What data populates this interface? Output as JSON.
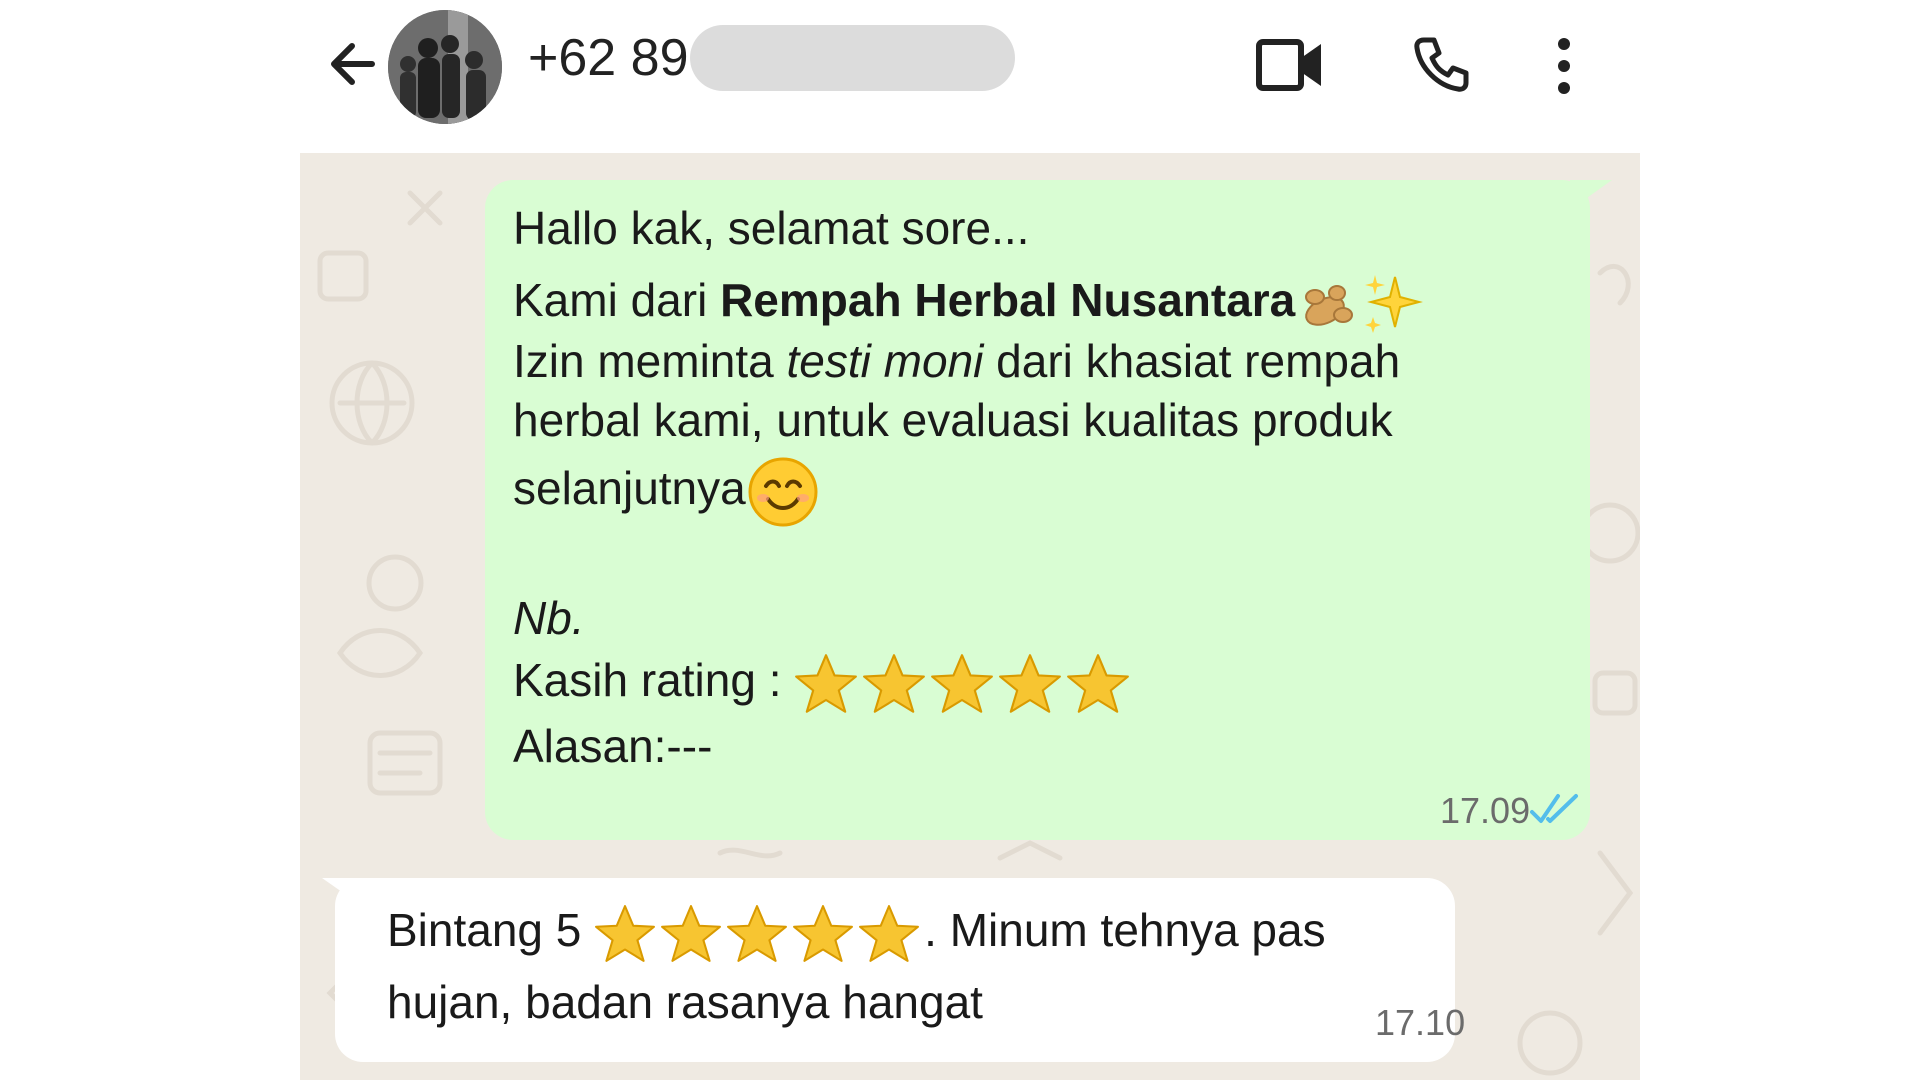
{
  "header": {
    "contact_number": "+62 89",
    "back_icon": "arrow-left-icon",
    "video_icon": "video-camera-icon",
    "call_icon": "phone-icon",
    "menu_icon": "more-vertical-icon"
  },
  "outgoing_message": {
    "line1": "Hallo kak, selamat sore...",
    "line2_prefix": "Kami dari ",
    "line2_brand": "Rempah Herbal Nusantara",
    "line3_prefix": "Izin meminta ",
    "line3_italic": "testi moni",
    "line3_suffix": " dari khasiat rempah",
    "line4": "herbal kami, untuk evaluasi kualitas produk",
    "line5": "selanjutnya",
    "note_label": "Nb.",
    "rating_label": "Kasih rating : ",
    "rating_stars": 5,
    "reason_label": "Alasan:---",
    "time": "17.09",
    "status_icon": "double-check-read-icon"
  },
  "incoming_message": {
    "prefix": "Bintang 5 ",
    "stars": 5,
    "suffix": ". Minum tehnya pas",
    "line2": "hujan, badan rasanya hangat",
    "time": "17.10"
  },
  "colors": {
    "outgoing_bubble": "#d9fdd3",
    "incoming_bubble": "#ffffff",
    "chat_background": "#efeae2",
    "read_tick": "#53bdeb",
    "star": "#f7c531"
  }
}
